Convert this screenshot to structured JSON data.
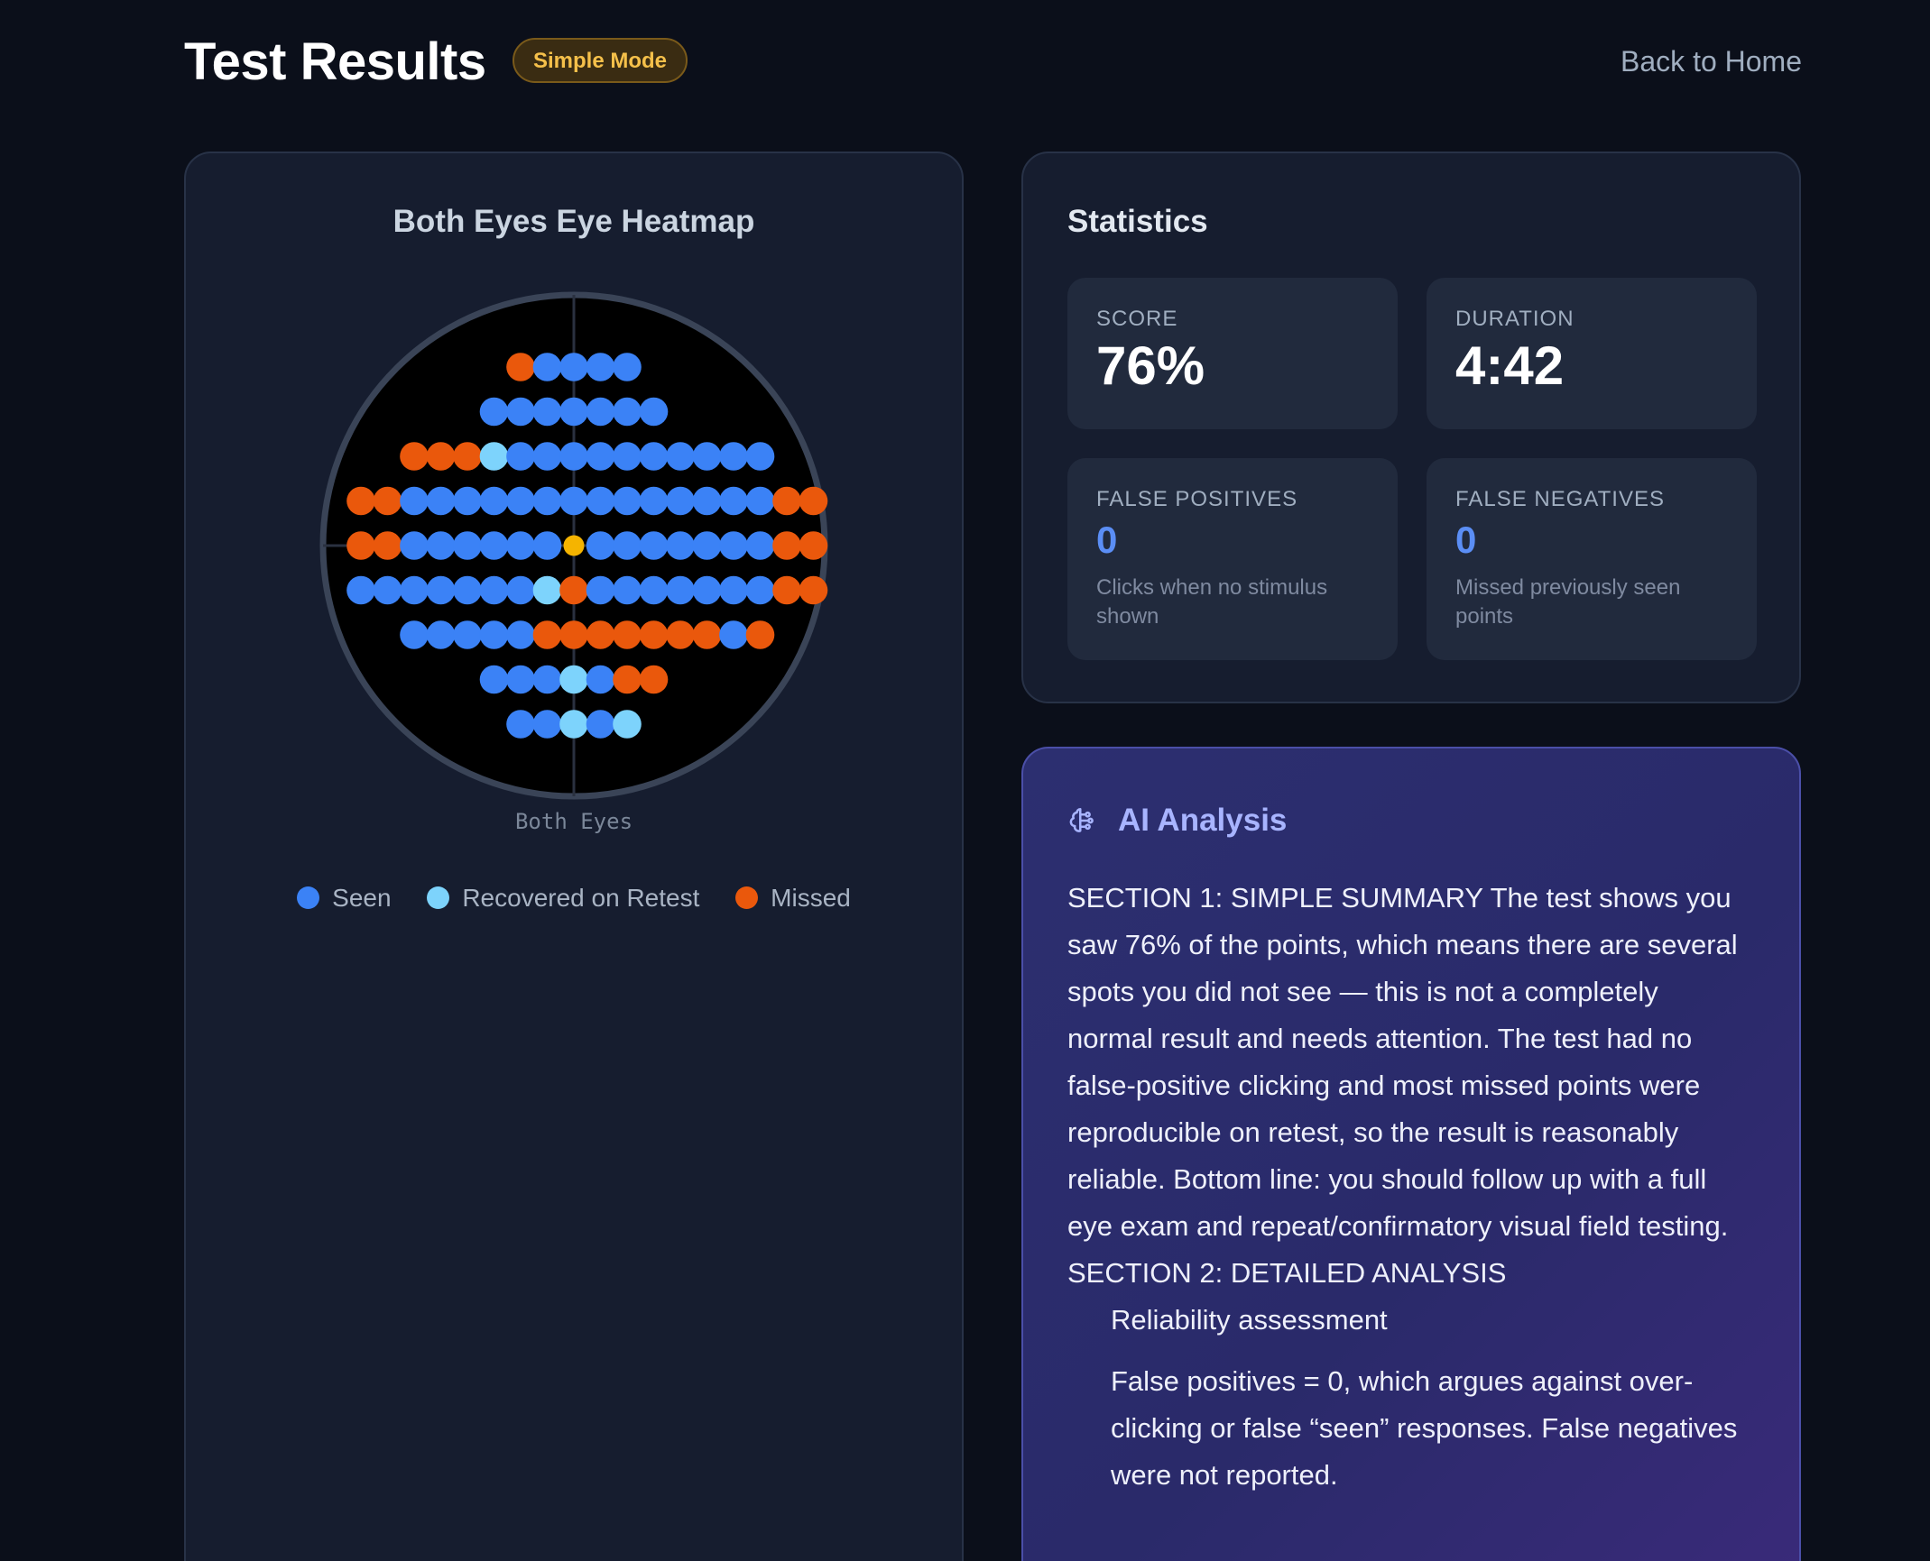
{
  "header": {
    "title": "Test Results",
    "mode_badge": "Simple Mode",
    "back_link": "Back to Home"
  },
  "heatmap": {
    "title": "Both Eyes Eye Heatmap",
    "eye_label": "Both Eyes",
    "legend": [
      {
        "label": "Seen",
        "color": "#3b82f6"
      },
      {
        "label": "Recovered on Retest",
        "color": "#7dd3fc"
      },
      {
        "label": "Missed",
        "color": "#ea580c"
      }
    ],
    "colors": {
      "seen": "#3b82f6",
      "recovered": "#7dd3fc",
      "missed": "#ea580c",
      "fixation": "#f5b400"
    },
    "rows": [
      {
        "start": -2,
        "points": "MSSSS"
      },
      {
        "start": -3,
        "points": "SSSSSSS"
      },
      {
        "start": -6,
        "points": "MMMRSSSSSSSSSS"
      },
      {
        "start": -8,
        "points": "MMSSSSSSSSSSSSSSMM"
      },
      {
        "start": -8,
        "points": "MMSSSSSSFSSSSSSSMM"
      },
      {
        "start": -8,
        "points": "SSSSSSSRMSSSSSSSMM"
      },
      {
        "start": -6,
        "points": "SSSSSMMMMMMMSM"
      },
      {
        "start": -3,
        "points": "SSSRSMM"
      },
      {
        "start": -2,
        "points": "SSRSR"
      }
    ]
  },
  "stats": {
    "title": "Statistics",
    "score": {
      "label": "SCORE",
      "value": "76%"
    },
    "duration": {
      "label": "DURATION",
      "value": "4:42"
    },
    "false_positives": {
      "label": "FALSE POSITIVES",
      "value": "0",
      "desc": "Clicks when no stimulus shown"
    },
    "false_negatives": {
      "label": "FALSE NEGATIVES",
      "value": "0",
      "desc": "Missed previously seen points"
    }
  },
  "ai": {
    "title": "AI Analysis",
    "icon": "brain-icon",
    "section1": "SECTION 1: SIMPLE SUMMARY The test shows you saw 76% of the points, which means there are several spots you did not see — this is not a completely normal result and needs attention. The test had no false-positive clicking and most missed points were reproducible on retest, so the result is reasonably reliable. Bottom line: you should follow up with a full eye exam and repeat/confirmatory visual field testing.",
    "section2": "SECTION 2: DETAILED ANALYSIS",
    "subheading": "Reliability assessment",
    "paragraph": "False positives = 0, which argues against over-clicking or false “seen” responses. False negatives were not reported."
  }
}
